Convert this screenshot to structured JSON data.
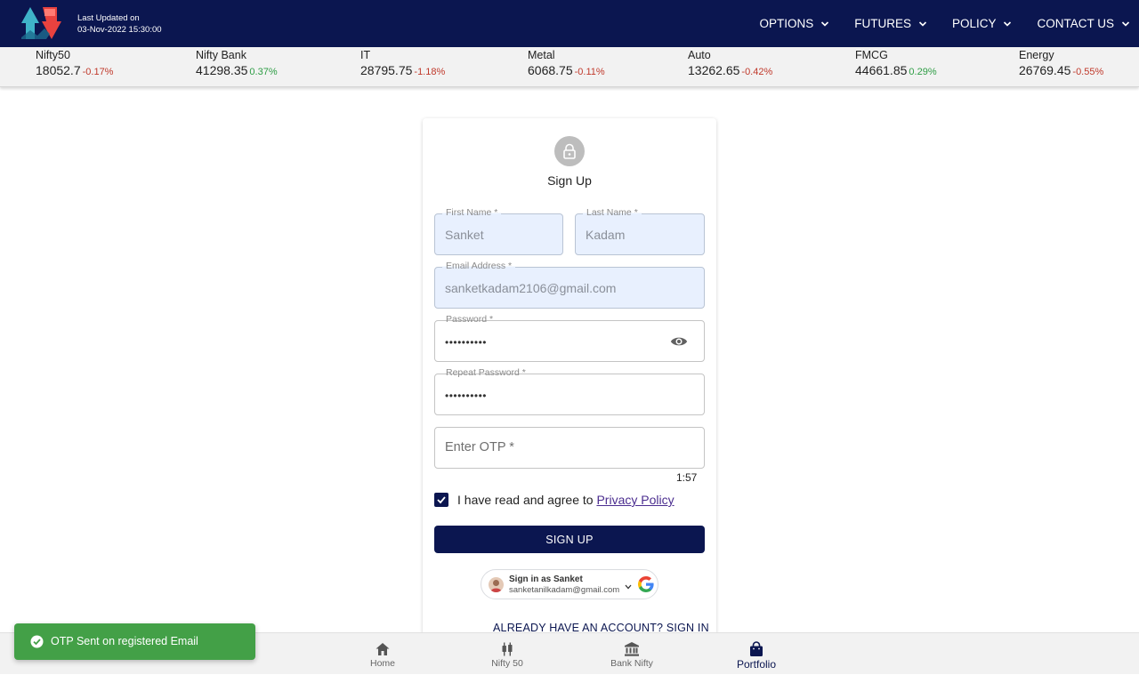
{
  "header": {
    "updated_label": "Last Updated on",
    "updated_time": "03-Nov-2022 15:30:00",
    "nav": [
      {
        "label": "OPTIONS"
      },
      {
        "label": "FUTURES"
      },
      {
        "label": "POLICY"
      },
      {
        "label": "CONTACT US"
      }
    ]
  },
  "ticker": [
    {
      "name": "Nifty50",
      "value": "18052.7",
      "change": "-0.17%",
      "direction": "down"
    },
    {
      "name": "Nifty Bank",
      "value": "41298.35",
      "change": "0.37%",
      "direction": "up"
    },
    {
      "name": "IT",
      "value": "28795.75",
      "change": "-1.18%",
      "direction": "down"
    },
    {
      "name": "Metal",
      "value": "6068.75",
      "change": "-0.11%",
      "direction": "down"
    },
    {
      "name": "Auto",
      "value": "13262.65",
      "change": "-0.42%",
      "direction": "down"
    },
    {
      "name": "FMCG",
      "value": "44661.85",
      "change": "0.29%",
      "direction": "up"
    },
    {
      "name": "Energy",
      "value": "26769.45",
      "change": "-0.55%",
      "direction": "down"
    }
  ],
  "form": {
    "title": "Sign Up",
    "first_name": {
      "label": "First Name *",
      "value": "Sanket"
    },
    "last_name": {
      "label": "Last Name *",
      "value": "Kadam"
    },
    "email": {
      "label": "Email Address *",
      "value": "sanketkadam2106@gmail.com"
    },
    "password": {
      "label": "Password *",
      "value": "••••••••••"
    },
    "repeat_password": {
      "label": "Repeat Password *",
      "value": "••••••••••"
    },
    "otp": {
      "placeholder": "Enter OTP *"
    },
    "timer": "1:57",
    "agree_text": "I have read and agree to",
    "privacy_link": "Privacy Policy",
    "agree_checked": true,
    "submit_label": "SIGN UP",
    "google": {
      "title": "Sign in as Sanket",
      "email": "sanketanilkadam@gmail.com"
    },
    "signin_link": "ALREADY HAVE AN ACCOUNT? SIGN IN"
  },
  "bottom_nav": [
    {
      "label": "Home",
      "icon": "home-icon"
    },
    {
      "label": "Nifty 50",
      "icon": "candlestick-icon"
    },
    {
      "label": "Bank Nifty",
      "icon": "bank-icon"
    },
    {
      "label": "Portfolio",
      "icon": "shopping-bag-icon",
      "active": true
    }
  ],
  "toast": {
    "message": "OTP Sent on registered Email"
  },
  "colors": {
    "primary": "#0b1650",
    "negative": "#c0392b",
    "positive": "#2e9d45",
    "toast": "#43a047",
    "autofill": "#e8f0fe"
  }
}
